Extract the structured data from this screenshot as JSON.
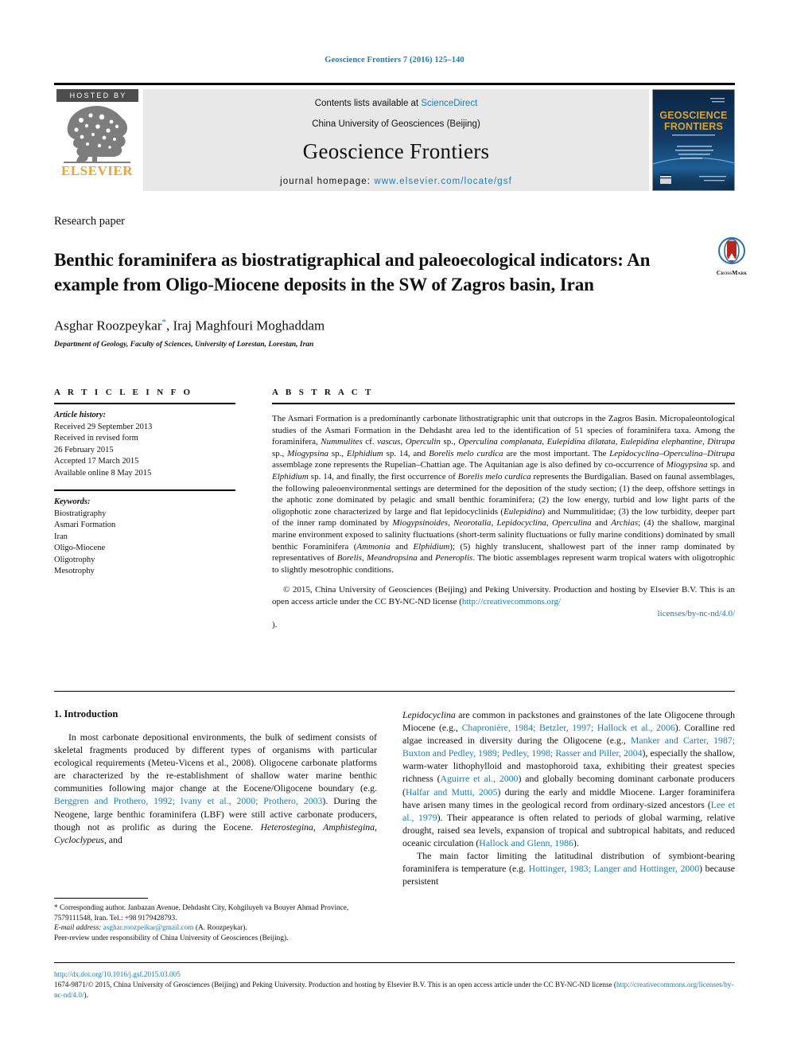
{
  "running_head": "Geoscience Frontiers 7 (2016) 125–140",
  "masthead": {
    "hosted_by": "HOSTED BY",
    "publisher_wordmark": "ELSEVIER",
    "tree_icon": "elsevier-tree-icon",
    "contents_prefix": "Contents lists available at ",
    "contents_link": "ScienceDirect",
    "society": "China University of Geosciences (Beijing)",
    "journal_title": "Geoscience Frontiers",
    "homepage_prefix": "journal homepage: ",
    "homepage_link": "www.elsevier.com/locate/gsf",
    "cover": {
      "title_line1": "GEOSCIENCE",
      "title_line2": "FRONTIERS",
      "alt": "journal-cover-thumbnail"
    }
  },
  "article": {
    "doctype": "Research paper",
    "title": "Benthic foraminifera as biostratigraphical and paleoecological indicators: An example from Oligo-Miocene deposits in the SW of Zagros basin, Iran",
    "authors": "Asghar Roozpeykar",
    "author_marker": "*",
    "authors_rest": ", Iraj Maghfouri Moghaddam",
    "affiliation": "Department of Geology, Faculty of Sciences, University of Lorestan, Lorestan, Iran",
    "crossmark_label": "CrossMark"
  },
  "article_info": {
    "heading": "A R T I C L E   I N F O",
    "history_label": "Article history:",
    "history": [
      "Received 29 September 2013",
      "Received in revised form",
      "26 February 2015",
      "Accepted 17 March 2015",
      "Available online 8 May 2015"
    ],
    "keywords_label": "Keywords:",
    "keywords": [
      "Biostratigraphy",
      "Asmari Formation",
      "Iran",
      "Oligo-Miocene",
      "Oligotrophy",
      "Mesotrophy"
    ]
  },
  "abstract": {
    "heading": "A B S T R A C T",
    "body_html": "The Asmari Formation is a predominantly carbonate lithostratigraphic unit that outcrops in the Zagros Basin. Micropaleontological studies of the Asmari Formation in the Dehdasht area led to the identification of 51 species of foraminifera taxa. Among the foraminifera, <i>Nummulites</i> cf. <i>vascus</i>, <i>Operculin</i> sp., <i>Operculina complanata</i>, <i>Eulepidina dilatata</i>, <i>Eulepidina elephantine</i>, <i>Ditrupa</i> sp., <i>Miogypsina</i> sp., <i>Elphidium</i> sp. 14, and <i>Borelis melo curdica</i> are the most important. The <i>Lepidocyclina</i>–<i>Operculina</i>–<i>Ditrupa</i> assemblage zone represents the Rupelian–Chattian age. The Aquitanian age is also defined by co-occurrence of <i>Miogypsina</i> sp. and <i>Elphidium</i> sp. 14, and finally, the first occurrence of <i>Borelis melo curdica</i> represents the Burdigalian. Based on faunal assemblages, the following paleoenvironmental settings are determined for the deposition of the study section; (1) the deep, offshore settings in the aphotic zone dominated by pelagic and small benthic foraminifera; (2) the low energy, turbid and low light parts of the oligophotic zone characterized by large and flat lepidocyclinids (<i>Eulepidina</i>) and Nummulitidae; (3) the low turbidity, deeper part of the inner ramp dominated by <i>Miogypsinoides</i>, <i>Neorotalia</i>, <i>Lepidocyclina</i>, <i>Operculina</i> and <i>Archias</i>; (4) the shallow, marginal marine environment exposed to salinity fluctuations (short-term salinity fluctuations or fully marine conditions) dominated by small benthic Foraminifera (<i>Ammonia</i> and <i>Elphidium</i>); (5) highly translucent, shallowest part of the inner ramp dominated by representatives of <i>Borelis</i>, <i>Meandropsina</i> and <i>Peneroplis</i>. The biotic assemblages represent warm tropical waters with oligotrophic to slightly mesotrophic conditions.",
    "copyright_html": "© 2015, China University of Geosciences (Beijing) and Peking University. Production and hosting by Elsevier B.V. This is an open access article under the CC BY-NC-ND license (<span class=\"link\">http://creativecommons.org/</span><span class=\"link cc-tail\">licenses/by-nc-nd/4.0/</span>)."
  },
  "introduction": {
    "heading": "1.  Introduction",
    "left_html": "In most carbonate depositional environments, the bulk of sediment consists of skeletal fragments produced by different types of organisms with particular ecological requirements (Meteu-Vicens et al., 2008). Oligocene carbonate platforms are characterized by the re-establishment of shallow water marine benthic communities following major change at the Eocene/Oligocene boundary (e.g. <span class=\"link\">Berggren and Prothero, 1992; Ivany et al., 2000; Prothero, 2003</span>). During the Neogene, large benthic foraminifera (LBF) were still active carbonate producers, though not as prolific as during the Eocene. <i>Heterostegina</i>, <i>Amphistegina</i>, <i>Cycloclypeus</i>, and",
    "right_html_1": "<i>Lepidocyclina</i> are common in packstones and grainstones of the late Oligocene through Miocene (e.g., <span class=\"link\">Chapronière, 1984; Betzler, 1997; Hallock et al., 2006</span>). Coralline red algae increased in diversity during the Oligocene (e.g., <span class=\"link\">Manker and Carter, 1987; Buxton and Pedley, 1989; Pedley, 1998; Rasser and Piller, 2004</span>), especially the shallow, warm-water lithophylloid and mastophoroid taxa, exhibiting their greatest species richness (<span class=\"link\">Aguirre et al., 2000</span>) and globally becoming dominant carbonate producers (<span class=\"link\">Halfar and Mutti, 2005</span>) during the early and middle Miocene. Larger foraminifera have arisen many times in the geological record from ordinary-sized ancestors (<span class=\"link\">Lee et al., 1979</span>). Their appearance is often related to periods of global warming, relative drought, raised sea levels, expansion of tropical and subtropical habitats, and reduced oceanic circulation (<span class=\"link\">Hallock and Glenn, 1986</span>).",
    "right_html_2": "The main factor limiting the latitudinal distribution of symbiont-bearing foraminifera is temperature (e.g. <span class=\"link\">Hottinger, 1983; Langer and Hottinger, 2000</span>) because persistent"
  },
  "footnote": {
    "corresponding_html": "* Corresponding author. Janbazan Avenue, Dehdasht City, Kohgiluyeh va Bouyer Ahmad Province, 7579111548, Iran. Tel.: +98 9179428793.",
    "email_label": "E-mail address:",
    "email": "asghar.roozpeikar@gmail.com",
    "email_suffix": "(A. Roozpeykar).",
    "peer_review": "Peer-review under responsibility of China University of Geosciences (Beijing)."
  },
  "bottom": {
    "doi": "http://dx.doi.org/10.1016/j.gsf.2015.03.005",
    "license_html": "1674-9871/© 2015, China University of Geosciences (Beijing) and Peking University. Production and hosting by Elsevier B.V. This is an open access article under the CC BY-NC-ND license (<span class=\"link\">http://creativecommons.org/licenses/by-nc-nd/4.0/</span>)."
  },
  "colors": {
    "link": "#1a7db6",
    "elsevier_orange": "#e8a33d",
    "masthead_grey": "#e8e8e8",
    "crossmark_red": "#b5281e"
  }
}
